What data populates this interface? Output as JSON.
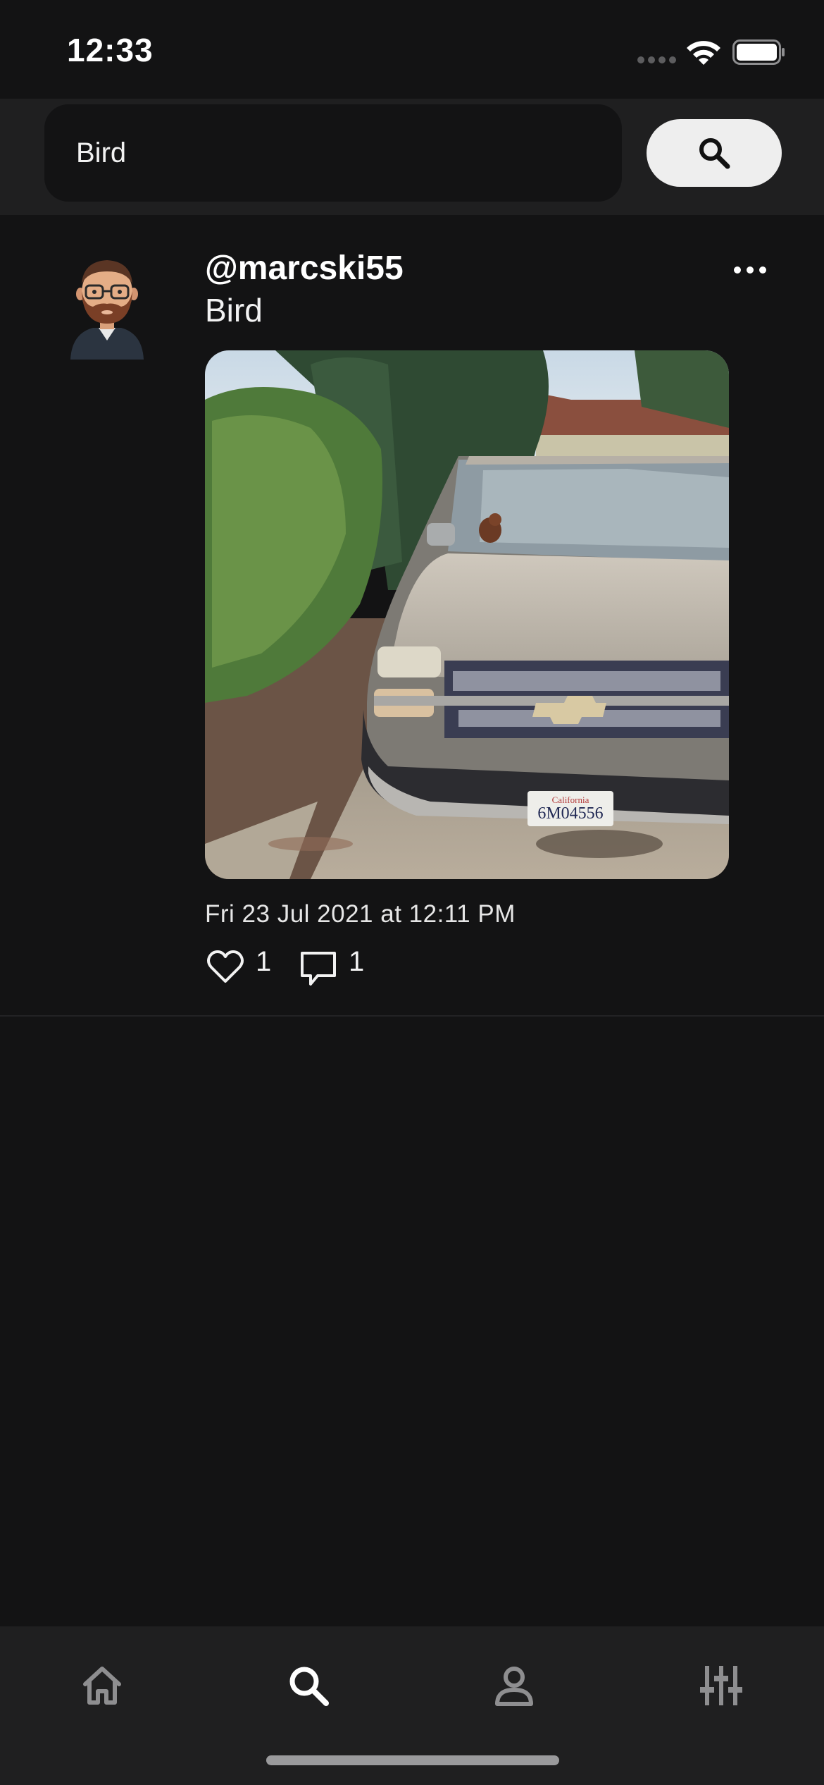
{
  "status_bar": {
    "time": "12:33"
  },
  "search": {
    "query": "Bird",
    "button_icon": "search-icon"
  },
  "post": {
    "username": "@marcski55",
    "text": "Bird",
    "timestamp": "Fri 23 Jul 2021 at 12:11 PM",
    "likes": "1",
    "comments": "1",
    "image_description_icon": "photo",
    "plate_text": "6M04556"
  },
  "tab_bar": {
    "items": [
      {
        "icon": "home-icon",
        "active": false
      },
      {
        "icon": "search-icon",
        "active": true
      },
      {
        "icon": "profile-icon",
        "active": false
      },
      {
        "icon": "settings-sliders-icon",
        "active": false
      }
    ]
  },
  "colors": {
    "background": "#131314",
    "bar_background": "#1f1f20",
    "active_tab": "#ffffff",
    "inactive_tab": "#8e8e90",
    "search_button": "#eeeeee"
  }
}
